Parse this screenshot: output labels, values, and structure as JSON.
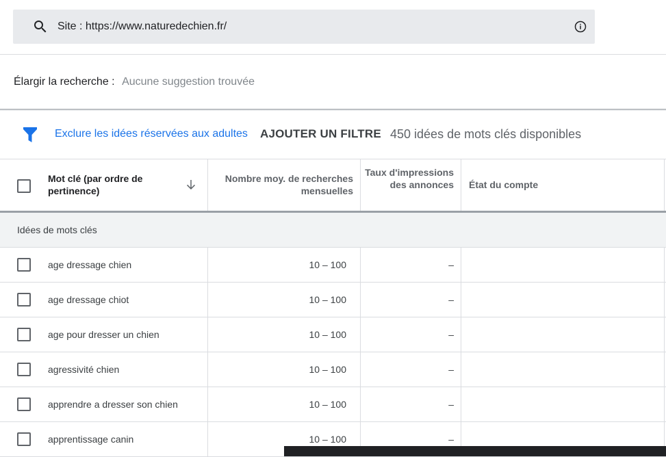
{
  "search": {
    "text": "Site : https://www.naturedechien.fr/"
  },
  "broaden": {
    "label": "Élargir la recherche :",
    "value": "Aucune suggestion trouvée"
  },
  "filters": {
    "exclude_adult_label": "Exclure les idées réservées aux adultes",
    "add_filter_label": "AJOUTER UN FILTRE",
    "ideas_count": "450 idées de mots clés disponibles"
  },
  "table": {
    "headers": {
      "keyword": "Mot clé (par ordre de pertinence)",
      "searches": "Nombre moy. de recherches mensuelles",
      "impression_share": "Taux d'impressions des annonces",
      "account_status": "État du compte"
    },
    "group_label": "Idées de mots clés",
    "rows": [
      {
        "keyword": "age dressage chien",
        "searches": "10 – 100",
        "impression_share": "–"
      },
      {
        "keyword": "age dressage chiot",
        "searches": "10 – 100",
        "impression_share": "–"
      },
      {
        "keyword": "age pour dresser un chien",
        "searches": "10 – 100",
        "impression_share": "–"
      },
      {
        "keyword": "agressivité chien",
        "searches": "10 – 100",
        "impression_share": "–"
      },
      {
        "keyword": "apprendre a dresser son chien",
        "searches": "10 – 100",
        "impression_share": "–"
      },
      {
        "keyword": "apprentissage canin",
        "searches": "10 – 100",
        "impression_share": "–"
      }
    ]
  },
  "colors": {
    "accent": "#1a73e8",
    "searchbar_bg": "#e8eaed",
    "group_bg": "#f1f3f4"
  }
}
